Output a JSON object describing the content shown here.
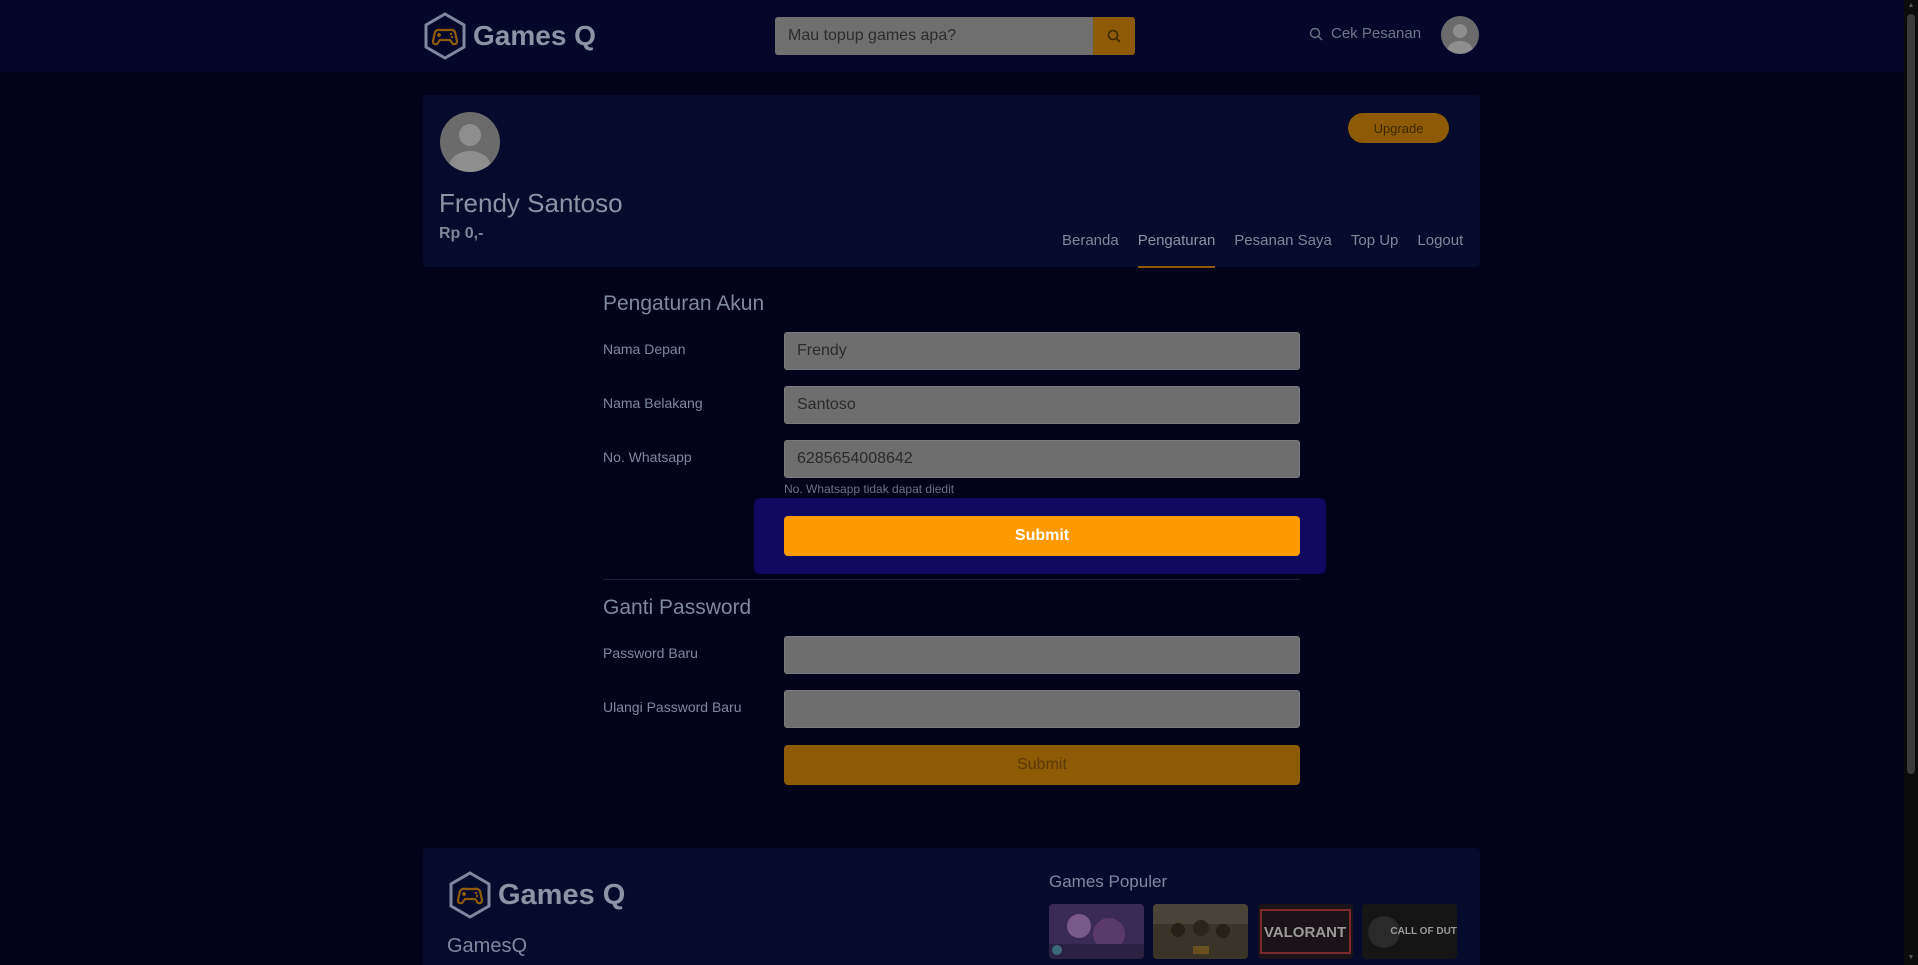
{
  "brand": {
    "name": "Games Q"
  },
  "navbar": {
    "search_placeholder": "Mau topup games apa?",
    "cek_pesanan": "Cek Pesanan"
  },
  "profile": {
    "name": "Frendy Santoso",
    "balance": "Rp 0,-",
    "upgrade_label": "Upgrade",
    "tabs": [
      {
        "label": "Beranda"
      },
      {
        "label": "Pengaturan",
        "active": true
      },
      {
        "label": "Pesanan Saya"
      },
      {
        "label": "Top Up"
      },
      {
        "label": "Logout"
      }
    ]
  },
  "account_settings": {
    "title": "Pengaturan Akun",
    "first_name_label": "Nama Depan",
    "first_name_value": "Frendy",
    "last_name_label": "Nama Belakang",
    "last_name_value": "Santoso",
    "whatsapp_label": "No. Whatsapp",
    "whatsapp_value": "6285654008642",
    "whatsapp_hint": "No. Whatsapp tidak dapat diedit",
    "submit_label": "Submit"
  },
  "change_password": {
    "title": "Ganti Password",
    "new_password_label": "Password Baru",
    "new_password_value": "",
    "repeat_password_label": "Ulangi Password Baru",
    "repeat_password_value": "",
    "submit_label": "Submit"
  },
  "footer": {
    "brand_text": "GamesQ",
    "popular_title": "Games Populer",
    "games": [
      {
        "icon": "mobile-legends-thumb"
      },
      {
        "icon": "pubg-thumb"
      },
      {
        "icon": "valorant-thumb"
      },
      {
        "icon": "call-of-duty-thumb"
      }
    ],
    "game_thumb_texts": {
      "valorant": "VALORANT",
      "cod": "CALL OF DUTY"
    }
  },
  "colors": {
    "background": "#02021a",
    "navbar": "#04072a",
    "card": "#060a2c",
    "accent": "#ff9900",
    "accent_dim": "#8d5b05",
    "highlight": "#10085e"
  }
}
